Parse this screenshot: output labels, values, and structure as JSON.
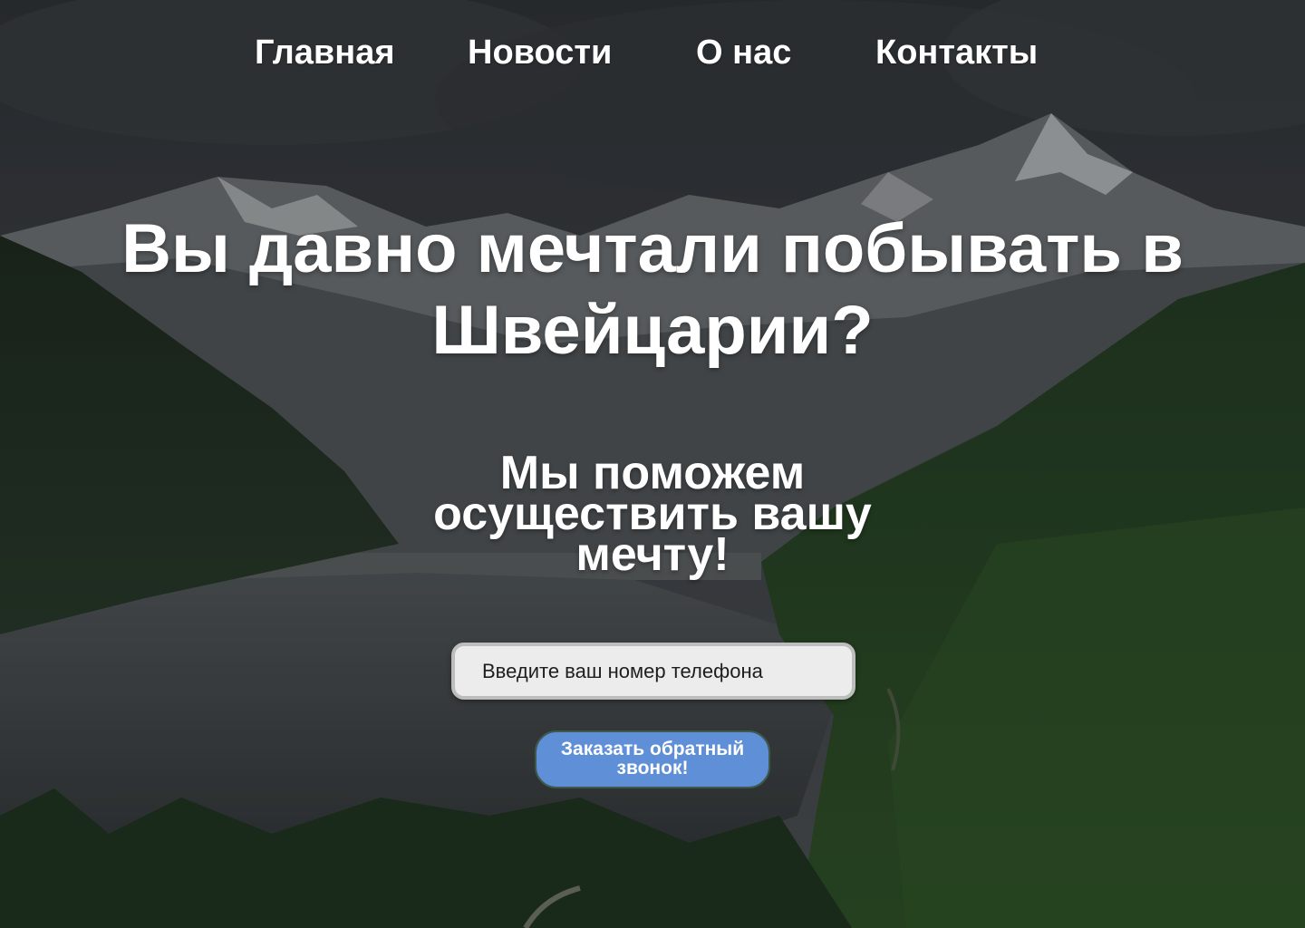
{
  "nav": {
    "items": [
      {
        "label": "Главная"
      },
      {
        "label": "Новости"
      },
      {
        "label": "О нас"
      },
      {
        "label": "Контакты"
      }
    ]
  },
  "hero": {
    "title": "Вы давно мечтали побывать в Швейцарии?",
    "subtitle": "Мы поможем осуществить вашу мечту!",
    "background": "mountain-lake-landscape"
  },
  "form": {
    "phone_placeholder": "Введите ваш номер телефона",
    "phone_value": "",
    "submit_label": "Заказать обратный звонок!"
  },
  "colors": {
    "button_bg": "#5f8fd6",
    "text": "#ffffff",
    "input_bg": "#ececec"
  }
}
